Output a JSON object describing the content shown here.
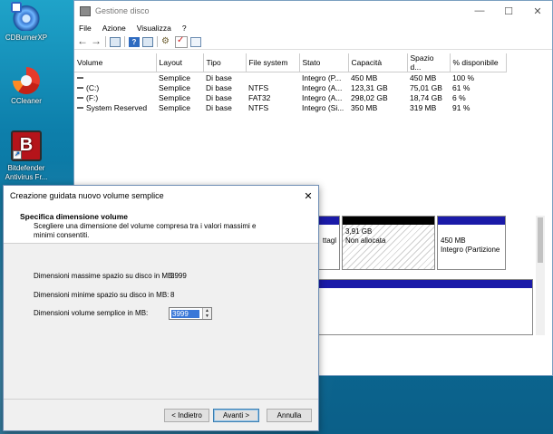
{
  "desktop": {
    "icons": [
      {
        "label": "CDBurnerXP",
        "icon": "cdburnerxp-icon"
      },
      {
        "label": "CCleaner",
        "icon": "ccleaner-icon"
      },
      {
        "label": "Bitdefender Antivirus Fr...",
        "icon": "bitdefender-icon"
      }
    ]
  },
  "window": {
    "title": "Gestione disco",
    "controls": {
      "minimize": "—",
      "maximize": "☐",
      "close": "✕"
    },
    "menu": [
      "File",
      "Azione",
      "Visualizza",
      "?"
    ],
    "table": {
      "headers": [
        "Volume",
        "Layout",
        "Tipo",
        "File system",
        "Stato",
        "Capacità",
        "Spazio d...",
        "% disponibile"
      ],
      "rows": [
        [
          "",
          "Semplice",
          "Di base",
          "",
          "Integro (P...",
          "450 MB",
          "450 MB",
          "100 %"
        ],
        [
          "(C:)",
          "Semplice",
          "Di base",
          "NTFS",
          "Integro (A...",
          "123,31 GB",
          "75,01 GB",
          "61 %"
        ],
        [
          "(F:)",
          "Semplice",
          "Di base",
          "FAT32",
          "Integro (A...",
          "298,02 GB",
          "18,74 GB",
          "6 %"
        ],
        [
          "System Reserved",
          "Semplice",
          "Di base",
          "NTFS",
          "Integro (Si...",
          "350 MB",
          "319 MB",
          "91 %"
        ]
      ]
    },
    "partitions": [
      {
        "line1": "",
        "line2": "ttagl"
      },
      {
        "line1": "3,91 GB",
        "line2": "Non allocata"
      },
      {
        "line1": "450 MB",
        "line2": "Integro (Partizione"
      }
    ]
  },
  "wizard": {
    "title": "Creazione guidata nuovo volume semplice",
    "close": "✕",
    "header_title": "Specifica dimensione volume",
    "header_desc": "Scegliere una dimensione del volume compresa tra i valori massimi e minimi consentiti.",
    "fields": [
      {
        "label": "Dimensioni massime spazio su disco in MB:",
        "value": "3999"
      },
      {
        "label": "Dimensioni minime spazio su disco in MB:",
        "value": "8"
      }
    ],
    "size_label": "Dimensioni volume semplice in MB:",
    "size_value": "3999",
    "buttons": {
      "back": "< Indietro",
      "next": "Avanti >",
      "cancel": "Annulla"
    }
  }
}
